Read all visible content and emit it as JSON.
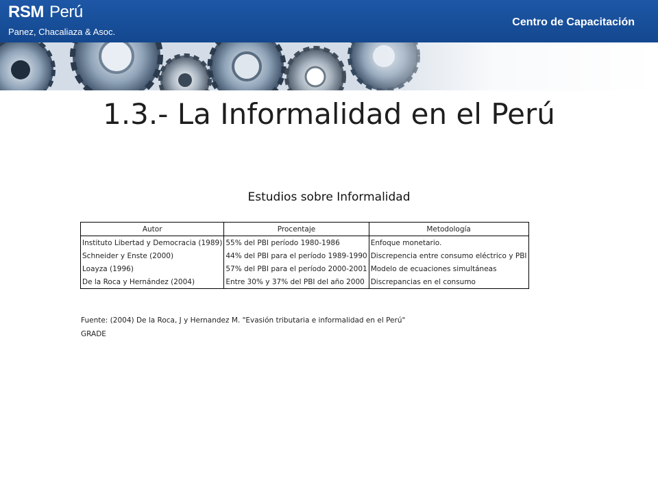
{
  "header": {
    "logo_brand": "RSM",
    "logo_country": "Perú",
    "logo_subtitle": "Panez, Chacaliaza & Asoc.",
    "right_title": "Centro de Capacitación",
    "colors": {
      "bar": "#1d57a6",
      "text": "#ffffff"
    }
  },
  "slide": {
    "title": "1.3.- La Informalidad en el Perú"
  },
  "studies": {
    "title": "Estudios sobre Informalidad",
    "columns": [
      "Autor",
      "Procentaje",
      "Metodología"
    ],
    "rows": [
      [
        "Instituto Libertad y Democracia (1989)",
        "55% del PBI período 1980-1986",
        "Enfoque monetario."
      ],
      [
        "Schneider y Enste (2000)",
        "44% del PBI para el período 1989-1990",
        "Discrepencia entre consumo eléctrico y PBI"
      ],
      [
        "Loayza (1996)",
        "57% del PBI para el período 2000-2001",
        "Modelo de ecuaciones simultáneas"
      ],
      [
        "De la Roca y Hernández (2004)",
        "Entre 30% y 37% del PBI del año 2000",
        "Discrepancias en el consumo"
      ]
    ],
    "source_line1": "Fuente: (2004) De la Roca, J y Hernandez M. \"Evasión tributaria e informalidad en el Perú\"",
    "source_line2": "GRADE"
  }
}
